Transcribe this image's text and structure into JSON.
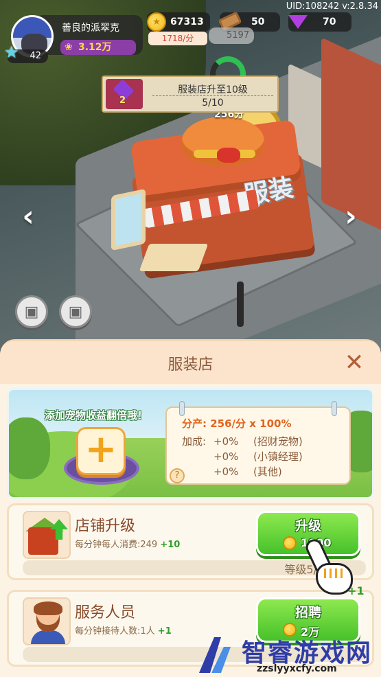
{
  "hud": {
    "uid_text": "UID:108242 v:2.8.34",
    "player": {
      "name": "善良的派翠克",
      "pet_income": "3.12万",
      "level": "42"
    },
    "resources": {
      "coins": "67313",
      "coin_rate": "1718/分",
      "wood": "50",
      "gems": "70",
      "earn_bubble": "5197"
    }
  },
  "quest": {
    "reward": "2",
    "title": "服装店升至10级",
    "progress": "5/10"
  },
  "scene": {
    "shop_sign": "服装",
    "badge_text": "256分"
  },
  "panel": {
    "title": "服装店",
    "pet_hint": "添加宠物收益翻倍哦！",
    "output_label": "分产: 256/分 x 100%",
    "bonus_label": "加成:",
    "bonuses": [
      {
        "value": "+0%",
        "source": "(招财宠物)"
      },
      {
        "value": "+0%",
        "source": "(小镇经理)"
      },
      {
        "value": "+0%",
        "source": "(其他)"
      }
    ],
    "upgrade_card": {
      "title": "店铺升级",
      "subtitle": "每分钟每人消费:249",
      "subtitle_plus": "+10",
      "button_label": "升级",
      "button_cost": "1000",
      "level_text": "等级5/"
    },
    "staff_card": {
      "title": "服务人员",
      "subtitle": "每分钟接待人数:1人",
      "subtitle_plus": "+1",
      "button_label": "招聘",
      "button_cost": "2万",
      "plus_one": "+1"
    }
  },
  "watermark": {
    "title": "智睿游戏网",
    "url": "zzslyyxcfy.com"
  },
  "colors": {
    "accent_green": "#46c12a",
    "title_brown": "#8a5a3a",
    "output_orange": "#e0651f",
    "gem_purple": "#b13ee0"
  }
}
